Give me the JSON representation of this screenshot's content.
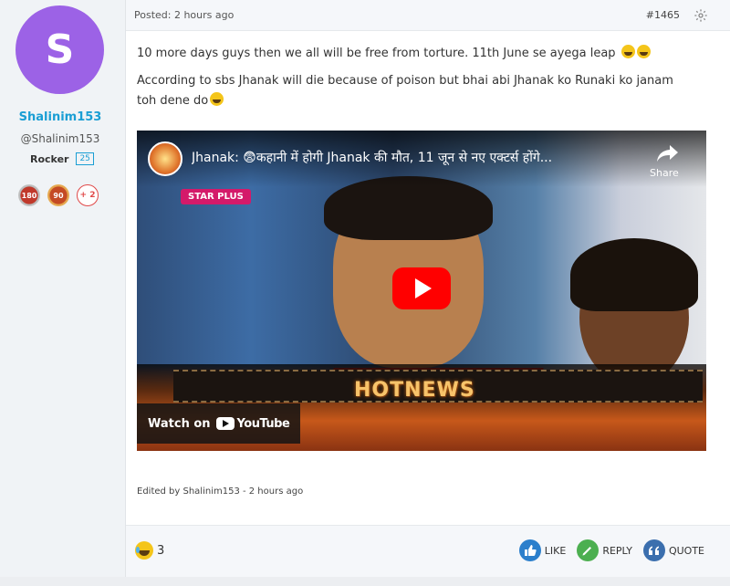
{
  "user": {
    "avatar_letter": "S",
    "avatar_color": "#9c62e6",
    "username": "Shalinim153",
    "handle": "@Shalinim153",
    "rank": "Rocker",
    "rank_count": "25",
    "badges": [
      "180",
      "90"
    ],
    "more_badges": "+ 2"
  },
  "post": {
    "posted": "Posted: 2 hours ago",
    "number": "#1465",
    "paragraph1": "10 more days guys then we all will be free from torture. 11th June se ayega leap",
    "paragraph2": "According to sbs Jhanak will die because of poison but bhai abi Jhanak ko Runaki ko janam toh dene do",
    "edited": "Edited by Shalinim153 - 2 hours ago"
  },
  "video": {
    "title": "Jhanak: 😨कहानी में होगी Jhanak की मौत, 11 जून से नए एक्टर्स होंगे...",
    "share_label": "Share",
    "channel_tag": "STAR PLUS",
    "banner_text": "HOTNEWS",
    "watch_on": "Watch on",
    "youtube": "YouTube"
  },
  "footer": {
    "reaction_count": "3",
    "like": "LIKE",
    "reply": "REPLY",
    "quote": "QUOTE"
  }
}
